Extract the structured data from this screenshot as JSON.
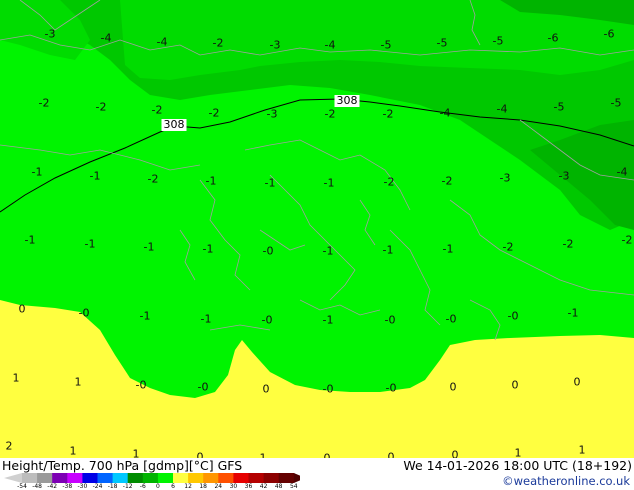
{
  "footer": {
    "left_title": "Height/Temp. 700 hPa [gdmp][°C] GFS",
    "right_title": "We 14-01-2026 18:00 UTC (18+192)",
    "credit": "©weatheronline.co.uk"
  },
  "contour_labels": [
    "308",
    "308"
  ],
  "colors": {
    "light_green": "#00f400",
    "mid_green": "#00dc00",
    "dark_green": "#00c800",
    "darker_green": "#00b400",
    "yellow": "#ffff40",
    "border_lines": "#a0a0a0",
    "contour": "#000000"
  },
  "temperature_labels": [
    "-3",
    "-4",
    "-4",
    "-2",
    "-3",
    "-4",
    "-5",
    "-5",
    "-5",
    "-6",
    "-6",
    "-2",
    "-2",
    "-2",
    "-2",
    "-3",
    "-2",
    "-2",
    "-4",
    "-4",
    "-5",
    "-5",
    "-1",
    "-1",
    "-2",
    "-1",
    "-1",
    "-1",
    "-2",
    "-2",
    "-3",
    "-3",
    "-4",
    "-1",
    "-1",
    "-1",
    "-1",
    "-0",
    "-1",
    "-1",
    "-1",
    "-2",
    "-2",
    "-2",
    "0",
    "-0",
    "-1",
    "-1",
    "-0",
    "-1",
    "-0",
    "-0",
    "-0",
    "-1",
    "1",
    "1",
    "-0",
    "-0",
    "0",
    "-0",
    "-0",
    "0",
    "0",
    "0",
    "2",
    "1",
    "1",
    "0",
    "1",
    "0",
    "0",
    "0",
    "1",
    "1"
  ],
  "color_scale": {
    "ticks": [
      "-54",
      "-48",
      "-42",
      "-38",
      "-30",
      "-24",
      "-18",
      "-12",
      "-6",
      "0",
      "6",
      "12",
      "18",
      "24",
      "30",
      "36",
      "42",
      "48",
      "54"
    ],
    "colors": [
      "#bdbdbd",
      "#9a9a9a",
      "#7d00b4",
      "#c800ff",
      "#0000e6",
      "#0064ff",
      "#00c8ff",
      "#008c00",
      "#00b400",
      "#00f400",
      "#ffff40",
      "#ffc800",
      "#ff9600",
      "#ff5000",
      "#e60000",
      "#b40000",
      "#8c0000",
      "#640000"
    ]
  }
}
